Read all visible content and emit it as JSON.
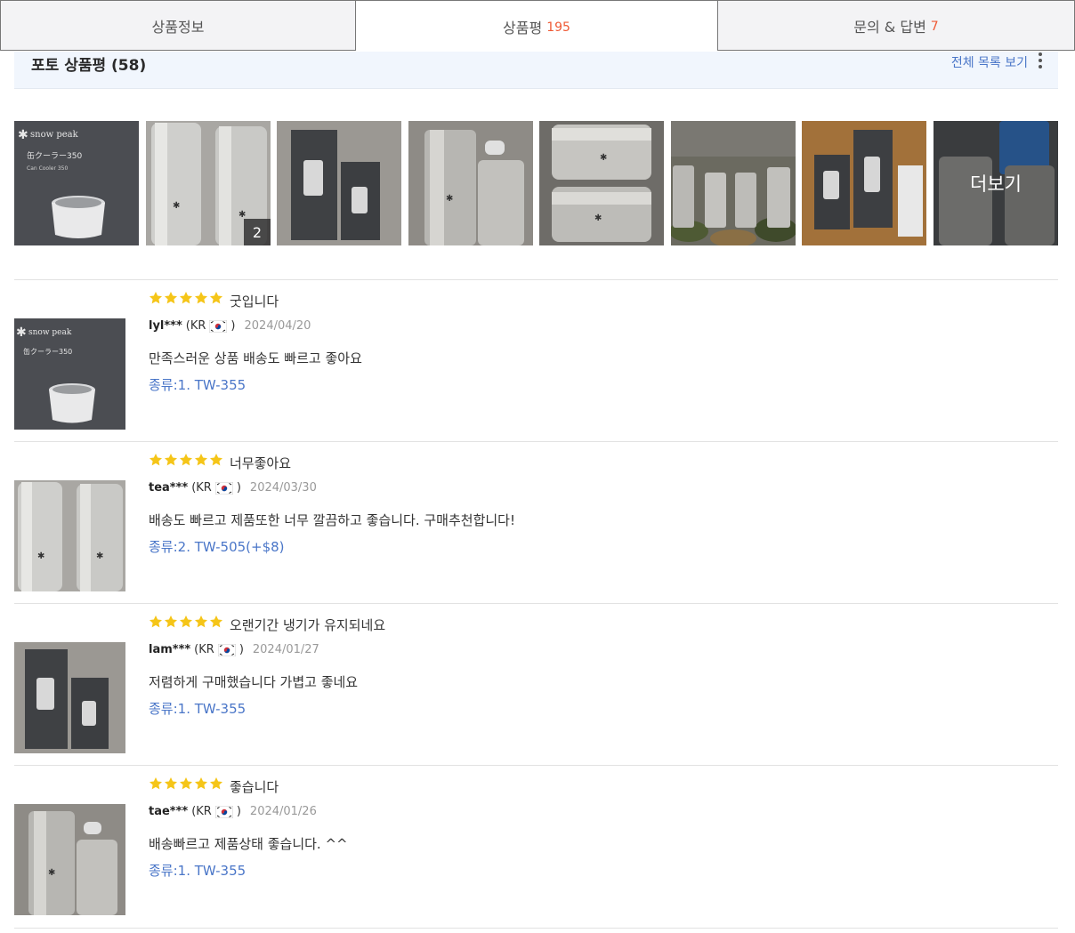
{
  "tabs": [
    {
      "label": "상품정보",
      "count": ""
    },
    {
      "label": "상품평",
      "count": "195"
    },
    {
      "label": "문의 & 답변",
      "count": "7"
    }
  ],
  "photo_reviews": {
    "title": "포토 상품평 (58)",
    "view_all": "전체 목록 보기",
    "thumb2_count": "2",
    "more_label": "더보기"
  },
  "reviews": [
    {
      "rating": 5,
      "title": "굿입니다",
      "user": "lyl***",
      "country": "(KR",
      "country_close": ")",
      "date": "2024/04/20",
      "body": "만족스러운 상품 배송도 빠르고 좋아요",
      "option": "종류:1. TW-355"
    },
    {
      "rating": 5,
      "title": "너무좋아요",
      "user": "tea***",
      "country": "(KR",
      "country_close": ")",
      "date": "2024/03/30",
      "body": "배송도 빠르고 제품또한 너무 깔끔하고 좋습니다. 구매추천합니다!",
      "option": "종류:2. TW-505(+$8)"
    },
    {
      "rating": 5,
      "title": "오랜기간 냉기가 유지되네요",
      "user": "lam***",
      "country": "(KR",
      "country_close": ")",
      "date": "2024/01/27",
      "body": "저렴하게 구매했습니다 가볍고 좋네요",
      "option": "종류:1. TW-355"
    },
    {
      "rating": 5,
      "title": "좋습니다",
      "user": "tae***",
      "country": "(KR",
      "country_close": ")",
      "date": "2024/01/26",
      "body": "배송빠르고 제품상태 좋습니다. ^^",
      "option": "종류:1. TW-355"
    }
  ],
  "colors": {
    "accent_count": "#ef5a35",
    "link": "#4a76c8",
    "star": "#f5c518"
  }
}
